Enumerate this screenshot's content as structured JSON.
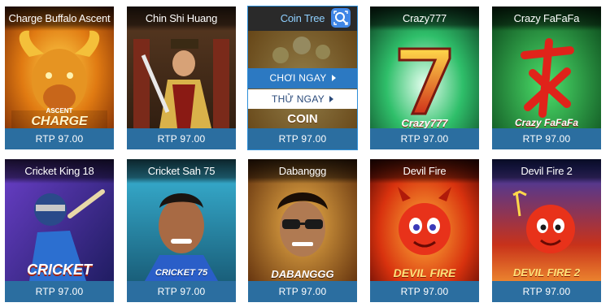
{
  "rtp_label_prefix": "RTP",
  "hover_actions": {
    "play_label": "CHƠI NGAY",
    "try_label": "THỬ NGAY"
  },
  "games": [
    {
      "title": "Charge Buffalo Ascent",
      "rtp": "RTP 97.00",
      "art_text_top": "ASCENT",
      "art_text_bottom": "CHARGE"
    },
    {
      "title": "Chin Shi Huang",
      "rtp": "RTP 97.00"
    },
    {
      "title": "Coin Tree",
      "rtp": "RTP 97.00",
      "art_text": "COIN"
    },
    {
      "title": "Crazy777",
      "rtp": "RTP 97.00",
      "art_text": "Crazy777"
    },
    {
      "title": "Crazy FaFaFa",
      "rtp": "RTP 97.00",
      "art_text": "Crazy FaFaFa"
    },
    {
      "title": "Cricket King 18",
      "rtp": "RTP 97.00",
      "art_text": "CRICKET"
    },
    {
      "title": "Cricket Sah 75",
      "rtp": "RTP 97.00",
      "art_text": "CRICKET 75"
    },
    {
      "title": "Dabanggg",
      "rtp": "RTP 97.00",
      "art_text": "DABANGGG"
    },
    {
      "title": "Devil Fire",
      "rtp": "RTP 97.00",
      "art_text": "DEVIL FIRE"
    },
    {
      "title": "Devil Fire 2",
      "rtp": "RTP 97.00",
      "art_text": "DEVIL FIRE 2"
    }
  ],
  "colors": {
    "rtp_bar": "#2b6ea0",
    "play_button": "#2c79c2",
    "hover_border": "#2f8fd8",
    "search_button": "#3f86e6"
  }
}
